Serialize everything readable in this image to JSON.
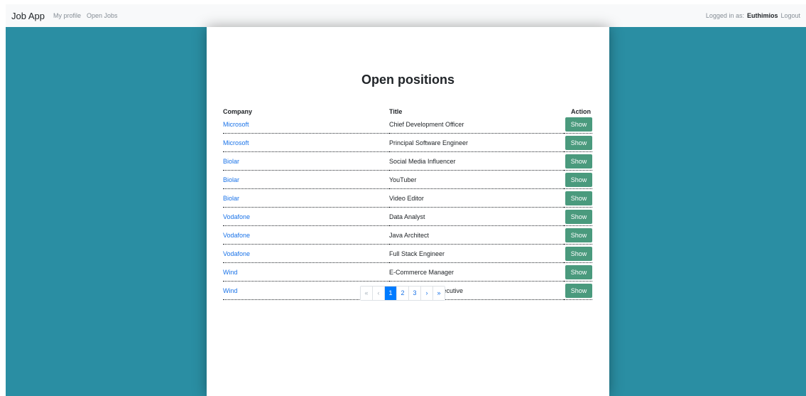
{
  "navbar": {
    "brand": "Job App",
    "links": [
      "My profile",
      "Open Jobs"
    ],
    "logged_in_label": "Logged in as:",
    "username": "Euthimios",
    "logout": "Logout"
  },
  "main": {
    "title": "Open positions",
    "columns": [
      "Company",
      "Title",
      "Action"
    ],
    "action_label": "Show",
    "rows": [
      {
        "company": "Microsoft",
        "title": "Chief Development Officer"
      },
      {
        "company": "Microsoft",
        "title": "Principal Software Engineer"
      },
      {
        "company": "Biolar",
        "title": "Social Media Influencer"
      },
      {
        "company": "Biolar",
        "title": "YouTuber"
      },
      {
        "company": "Biolar",
        "title": "Video Editor"
      },
      {
        "company": "Vodafone",
        "title": "Data Analyst"
      },
      {
        "company": "Vodafone",
        "title": "Java Architect"
      },
      {
        "company": "Vodafone",
        "title": "Full Stack Engineer"
      },
      {
        "company": "Wind",
        "title": "E-Commerce Manager"
      },
      {
        "company": "Wind",
        "title": "Technical Sales Executive"
      }
    ]
  },
  "pagination": {
    "first": "«",
    "prev": "‹",
    "pages": [
      "1",
      "2",
      "3"
    ],
    "current": "1",
    "next": "›",
    "last": "»"
  },
  "colors": {
    "background": "#2a8ea3",
    "link": "#1a73e8",
    "button": "#4a9a7d",
    "active_page": "#007bff"
  }
}
